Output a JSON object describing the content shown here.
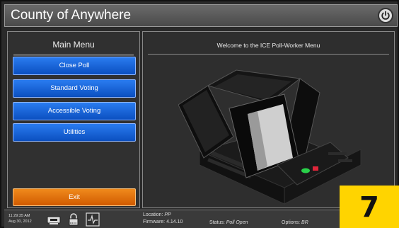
{
  "titlebar": {
    "title": "County of Anywhere"
  },
  "menu": {
    "title": "Main Menu",
    "items": [
      {
        "label": "Close Poll"
      },
      {
        "label": "Standard Voting"
      },
      {
        "label": "Accessible Voting"
      },
      {
        "label": "Utilities"
      }
    ],
    "exit_label": "Exit"
  },
  "content": {
    "welcome": "Welcome to the ICE Poll-Worker Menu"
  },
  "statusbar": {
    "time": "11:29:35 AM",
    "date": "Aug 30, 2012",
    "location_label": "Location:",
    "location_value": "PP",
    "firmware_label": "Firmware:",
    "firmware_value": "4.14.10",
    "status_label": "Status:",
    "status_value": "Poll Open",
    "options_label": "Options:",
    "options_value": "BR"
  },
  "badge": {
    "number": "7"
  },
  "colors": {
    "menu_button": "#0b4fc0",
    "exit_button": "#e06b00",
    "badge": "#ffd400"
  },
  "icons": [
    "power-icon",
    "printer-icon",
    "lock-icon",
    "signal-icon"
  ]
}
